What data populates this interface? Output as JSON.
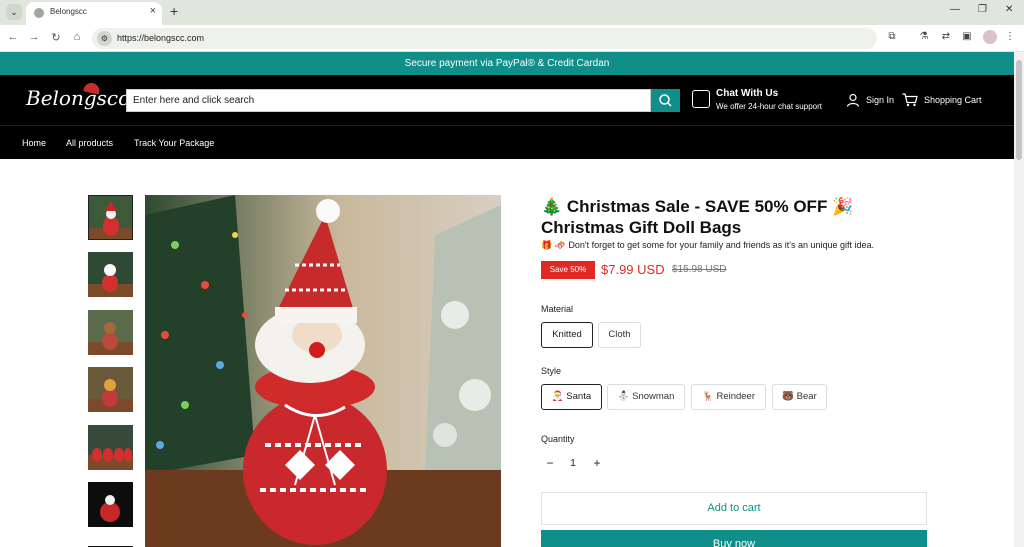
{
  "browser": {
    "tab_title": "Belongscc",
    "url": "https://belongscc.com"
  },
  "announcement": "Secure payment via PayPal® & Credit Cardan",
  "header": {
    "logo": "Belongscc",
    "search_placeholder": "Enter here and click search",
    "chat_title": "Chat With Us",
    "chat_subtitle": "We offer 24-hour chat support",
    "sign_in": "Sign In",
    "cart": "Shopping Cart"
  },
  "nav": {
    "items": [
      "Home",
      "All products",
      "Track Your Package"
    ]
  },
  "product": {
    "title_line1": "🎄 Christmas Sale - SAVE 50% OFF 🎉",
    "title_line2": "Christmas Gift Doll Bags",
    "subtitle": "🎁 🛷 Don't forget to get some for your family and friends as it's an unique gift idea.",
    "save_badge": "Save 50%",
    "price": "$7.99 USD",
    "compare_price": "$15.98 USD",
    "material_label": "Material",
    "materials": [
      "Knitted",
      "Cloth"
    ],
    "selected_material": "Knitted",
    "style_label": "Style",
    "styles": [
      "🎅 Santa",
      "⛄ Snowman",
      "🦌 Reindeer",
      "🐻 Bear"
    ],
    "selected_style": "🎅 Santa",
    "quantity_label": "Quantity",
    "quantity": "1",
    "add_to_cart": "Add to cart",
    "buy_now": "Buy now"
  },
  "colors": {
    "brand_teal": "#0f8e8a",
    "sale_red": "#e22822",
    "header_bg": "#000000"
  }
}
